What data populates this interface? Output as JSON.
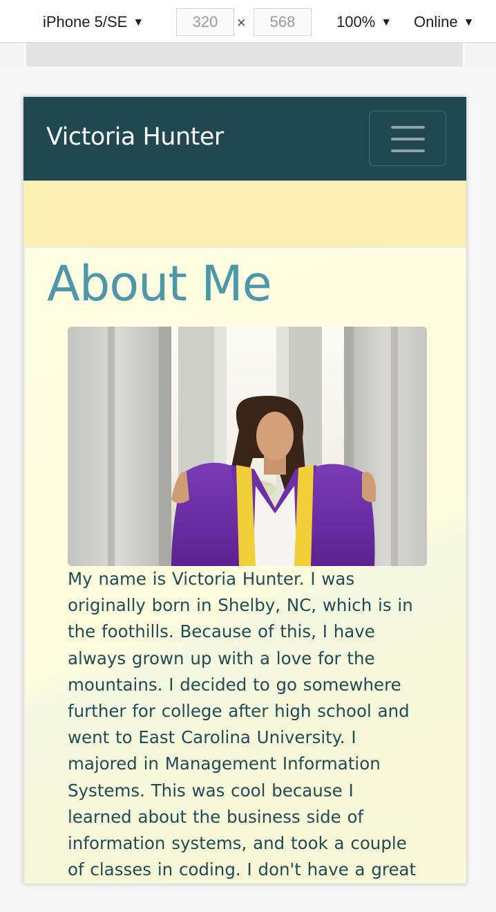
{
  "devtools": {
    "device": "iPhone 5/SE",
    "width_value": "320",
    "height_value": "568",
    "times": "×",
    "zoom": "100%",
    "throttling": "Online",
    "arrow": "▼"
  },
  "site": {
    "brand": "Victoria Hunter",
    "about_heading": "About Me",
    "bio_lines": [
      "My name is Victoria Hunter. I was",
      "originally born in Shelby, NC, which is in",
      "the foothills. Because of this, I have",
      "always grown up with a love for the",
      "mountains. I decided to go somewhere",
      "further for college after high school and",
      "went to East Carolina University. I",
      "majored in Management Information",
      "Systems. This was cool because I",
      "learned about the business side of",
      "information systems, and took a couple",
      "of classes in coding. I don't have a great"
    ]
  },
  "colors": {
    "navbar": "#1f4851",
    "heading": "#4d97a9",
    "body_text": "#234b54",
    "band": "#fcefb4"
  }
}
